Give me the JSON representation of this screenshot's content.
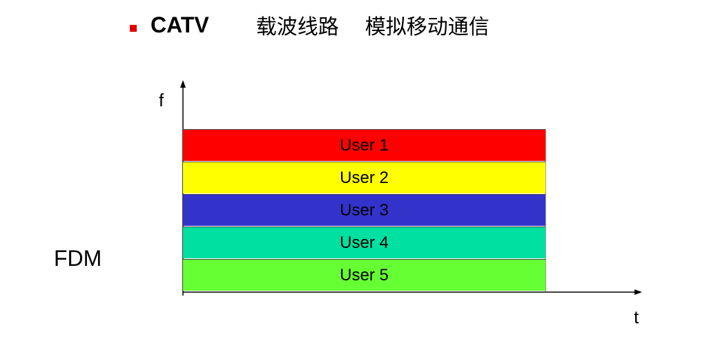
{
  "header": {
    "title": "CATV",
    "items": [
      "载波线路",
      "模拟移动通信"
    ]
  },
  "diagram": {
    "label": "FDM",
    "y_axis": "f",
    "x_axis": "t",
    "bands": [
      {
        "label": "User 1",
        "color": "#ff0000"
      },
      {
        "label": "User 2",
        "color": "#ffff00"
      },
      {
        "label": "User 3",
        "color": "#3333cc"
      },
      {
        "label": "User 4",
        "color": "#00e0a0"
      },
      {
        "label": "User 5",
        "color": "#66ff33"
      }
    ]
  },
  "colors": {
    "bullet": "#e00000"
  }
}
